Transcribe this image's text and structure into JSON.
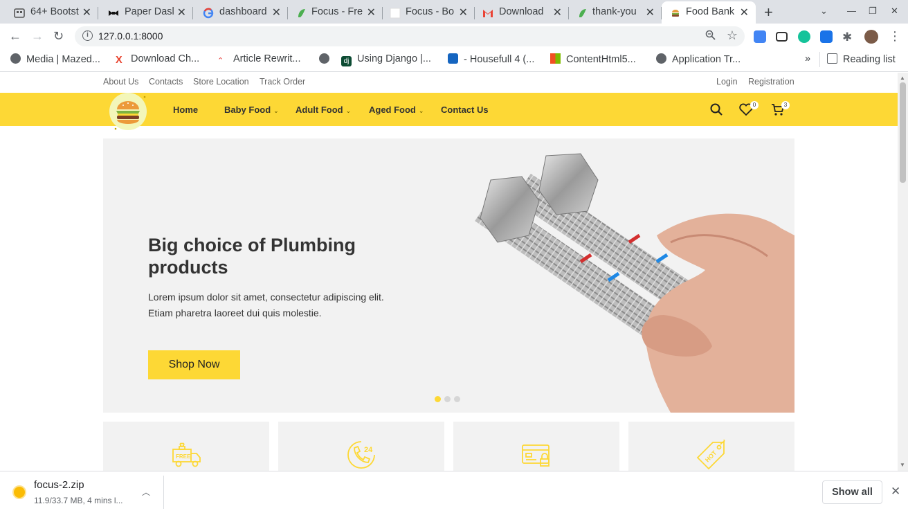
{
  "browser": {
    "tabs": [
      {
        "title": "64+ Bootst",
        "icon": "bootstrap-icon"
      },
      {
        "title": "Paper Dasl",
        "icon": "bowtie-icon"
      },
      {
        "title": "dashboard",
        "icon": "google-icon"
      },
      {
        "title": "Focus - Fre",
        "icon": "focus-icon"
      },
      {
        "title": "Focus - Bo",
        "icon": "blank-page-icon"
      },
      {
        "title": "Download",
        "icon": "gmail-icon"
      },
      {
        "title": "thank-you",
        "icon": "focus-icon"
      },
      {
        "title": "Food Bank",
        "icon": "burger-icon",
        "active": true
      }
    ],
    "url": "127.0.0.1:8000",
    "bookmarks": [
      {
        "label": "Media | Mazed...",
        "icon": "globe-icon"
      },
      {
        "label": "Download Ch...",
        "icon": "x-logo-icon"
      },
      {
        "label": "Article Rewrit...",
        "icon": "article-icon"
      },
      {
        "label": "",
        "icon": "globe-icon"
      },
      {
        "label": "Using Django |...",
        "icon": "django-icon"
      },
      {
        "label": "- Housefull 4 (...",
        "icon": "tp-icon"
      },
      {
        "label": "ContentHtml5...",
        "icon": "microsoft-icon"
      },
      {
        "label": "Application Tr...",
        "icon": "globe-icon"
      }
    ],
    "more": "»",
    "reading_list": "Reading list",
    "colors": {
      "chrome": "#dee1e6",
      "accent": "#fdd835"
    }
  },
  "site": {
    "topbar": {
      "left": [
        "About Us",
        "Contacts",
        "Store Location",
        "Track Order"
      ],
      "right": [
        "Login",
        "Registration"
      ]
    },
    "nav": {
      "items": [
        {
          "label": "Home",
          "dropdown": false
        },
        {
          "label": "Baby Food",
          "dropdown": true
        },
        {
          "label": "Adult Food",
          "dropdown": true
        },
        {
          "label": "Aged Food",
          "dropdown": true
        },
        {
          "label": "Contact Us",
          "dropdown": false
        }
      ],
      "wishlist_count": "0",
      "cart_count": "3"
    },
    "hero": {
      "title": "Big choice of Plumbing products",
      "text": "Lorem ipsum dolor sit amet, consectetur adipiscing elit. Etiam pharetra laoreet dui quis molestie.",
      "button": "Shop Now",
      "slides": 3,
      "active_slide": 1
    },
    "features": [
      {
        "icon": "free-delivery-truck-icon"
      },
      {
        "icon": "24h-support-phone-icon"
      },
      {
        "icon": "secure-payment-card-icon"
      },
      {
        "icon": "hot-deal-tag-icon"
      }
    ]
  },
  "downloads": {
    "file": "focus-2.zip",
    "status": "11.9/33.7 MB, 4 mins l...",
    "show_all": "Show all"
  }
}
